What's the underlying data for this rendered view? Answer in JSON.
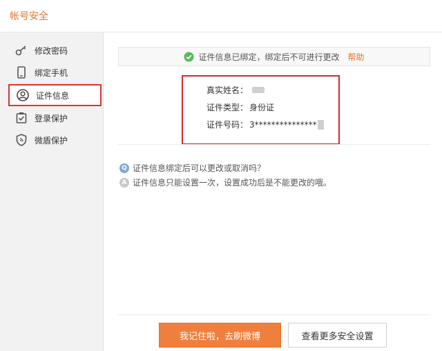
{
  "header": {
    "title": "帐号安全"
  },
  "sidebar": {
    "items": [
      {
        "label": "修改密码",
        "icon": "key-icon"
      },
      {
        "label": "绑定手机",
        "icon": "phone-icon"
      },
      {
        "label": "证件信息",
        "icon": "user-circle-icon",
        "active": true
      },
      {
        "label": "登录保护",
        "icon": "clipboard-check-icon"
      },
      {
        "label": "微盾保护",
        "icon": "shield-icon"
      }
    ]
  },
  "notice": {
    "text": "证件信息已绑定，绑定后不可进行更改",
    "help": "帮助"
  },
  "info": {
    "name_label": "真实姓名：",
    "name_value": "",
    "type_label": "证件类型：",
    "type_value": "身份证",
    "number_label": "证件号码：",
    "number_value": "3***************"
  },
  "faq": {
    "q_badge": "Q",
    "q_text": "证件信息绑定后可以更改或取消吗？",
    "a_badge": "A",
    "a_text": "证件信息只能设置一次，设置成功后是不能更改的哦。"
  },
  "actions": {
    "primary": "我记住啦，去刷微博",
    "secondary": "查看更多安全设置"
  },
  "colors": {
    "accent": "#e8732c",
    "highlight": "#d9262a",
    "check": "#5cb85c"
  }
}
